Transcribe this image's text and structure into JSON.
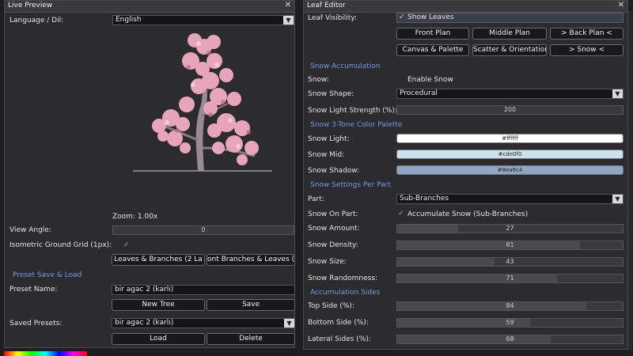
{
  "live_preview": {
    "title": "Live Preview",
    "language_label": "Language / Dil:",
    "language_value": "English",
    "zoom_text": "Zoom: 1.00x",
    "view_angle_label": "View Angle:",
    "view_angle_value": "0",
    "view_angle_fraction": 0.0,
    "grid_label": "Isometric Ground Grid (1px):",
    "grid_checked": true,
    "order_btn_1": "Leaves & Branches (2 La",
    "order_btn_2": "ont Branches & Leaves (2",
    "preset_section": "Preset Save & Load",
    "preset_name_label": "Preset Name:",
    "preset_name_value": "bir agac 2 (karlı)",
    "new_tree_label": "New Tree",
    "save_label": "Save",
    "saved_presets_label": "Saved Presets:",
    "saved_presets_value": "bir agac 2 (karlı)",
    "load_label": "Load",
    "delete_label": "Delete"
  },
  "leaf_editor": {
    "title": "Leaf Editor",
    "leaf_visibility_label": "Leaf Visibility:",
    "show_leaves_label": "Show Leaves",
    "show_leaves_checked": true,
    "plan_buttons": [
      "Front Plan",
      "Middle Plan",
      "> Back Plan <"
    ],
    "tool_buttons": [
      "Canvas & Palette",
      "Scatter & Orientation",
      "> Snow <"
    ],
    "snow_accumulation_section": "Snow Accumulation",
    "snow_label": "Snow:",
    "enable_snow_label": "Enable Snow",
    "snow_shape_label": "Snow Shape:",
    "snow_shape_value": "Procedural",
    "snow_light_strength_label": "Snow Light Strength (%):",
    "snow_light_strength_value": "200",
    "palette_section": "Snow 3-Tone Color Palette",
    "palette": [
      {
        "label": "Snow Light:",
        "hex": "#ffffff",
        "color": "#ffffff"
      },
      {
        "label": "Snow Mid:",
        "hex": "#cde0f0",
        "color": "#cde0f0"
      },
      {
        "label": "Snow Shadow:",
        "hex": "#8ea6c4",
        "color": "#8ea6c4"
      }
    ],
    "per_part_section": "Snow Settings Per Part",
    "part_label": "Part:",
    "part_value": "Sub-Branches",
    "snow_on_part_label": "Snow On Part:",
    "accumulate_label": "Accumulate Snow (Sub-Branches)",
    "part_sliders": [
      {
        "label": "Snow Amount:",
        "value": "27",
        "fraction": 0.27
      },
      {
        "label": "Snow Density:",
        "value": "81",
        "fraction": 0.81
      },
      {
        "label": "Snow Size:",
        "value": "43",
        "fraction": 0.43
      },
      {
        "label": "Snow Randomness:",
        "value": "71",
        "fraction": 0.71
      }
    ],
    "sides_section": "Accumulation Sides",
    "side_sliders": [
      {
        "label": "Top Side (%):",
        "value": "84",
        "fraction": 0.84
      },
      {
        "label": "Bottom Side (%):",
        "value": "59",
        "fraction": 0.59
      },
      {
        "label": "Lateral Sides (%):",
        "value": "68",
        "fraction": 0.68
      }
    ]
  },
  "colors": {
    "accent_section": "#6f9be8",
    "blossom": "#e8a4b8",
    "trunk": "#9a8a94"
  }
}
